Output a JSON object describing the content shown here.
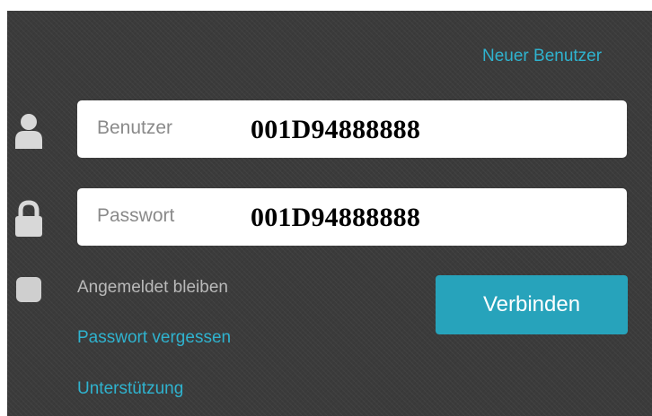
{
  "header": {
    "new_user_link": "Neuer Benutzer"
  },
  "form": {
    "username": {
      "placeholder": "Benutzer",
      "value": "001D94888888",
      "icon": "user-icon"
    },
    "password": {
      "placeholder": "Passwort",
      "value": "001D94888888",
      "icon": "lock-icon"
    },
    "remember_label": "Angemeldet bleiben",
    "connect_button": "Verbinden"
  },
  "links": {
    "forgot_password": "Passwort vergessen",
    "support": "Unterstützung"
  },
  "colors": {
    "background": "#3b3b3b",
    "accent_link": "#2fb3cf",
    "button": "#27a3bb",
    "field_bg": "#ffffff",
    "label": "#b9b9b9",
    "icon": "#d8d8d8"
  }
}
